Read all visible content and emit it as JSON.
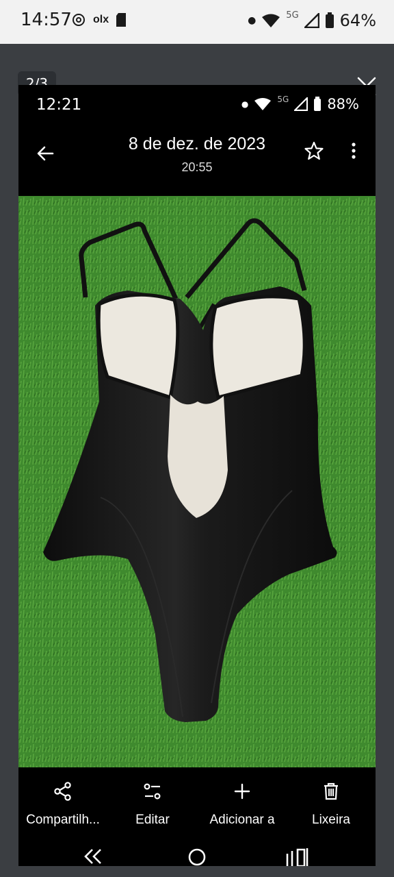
{
  "outer_status": {
    "time": "14:57",
    "olx": "olx",
    "network": "5G",
    "battery": "64%"
  },
  "viewer": {
    "counter": "2/3",
    "icons": [
      "close-icon"
    ]
  },
  "inner_status": {
    "time": "12:21",
    "network": "5G",
    "battery": "88%"
  },
  "appbar": {
    "title": "8 de dez. de 2023",
    "subtitle": "20:55",
    "icons": [
      "back-arrow-icon",
      "star-icon",
      "more-vert-icon"
    ]
  },
  "toolbar": {
    "share": "Compartilh...",
    "edit": "Editar",
    "add": "Adicionar a",
    "trash": "Lixeira"
  },
  "colors": {
    "grass": "#3f8a2e",
    "swimsuit": "#151515",
    "lining": "#ece8df"
  }
}
